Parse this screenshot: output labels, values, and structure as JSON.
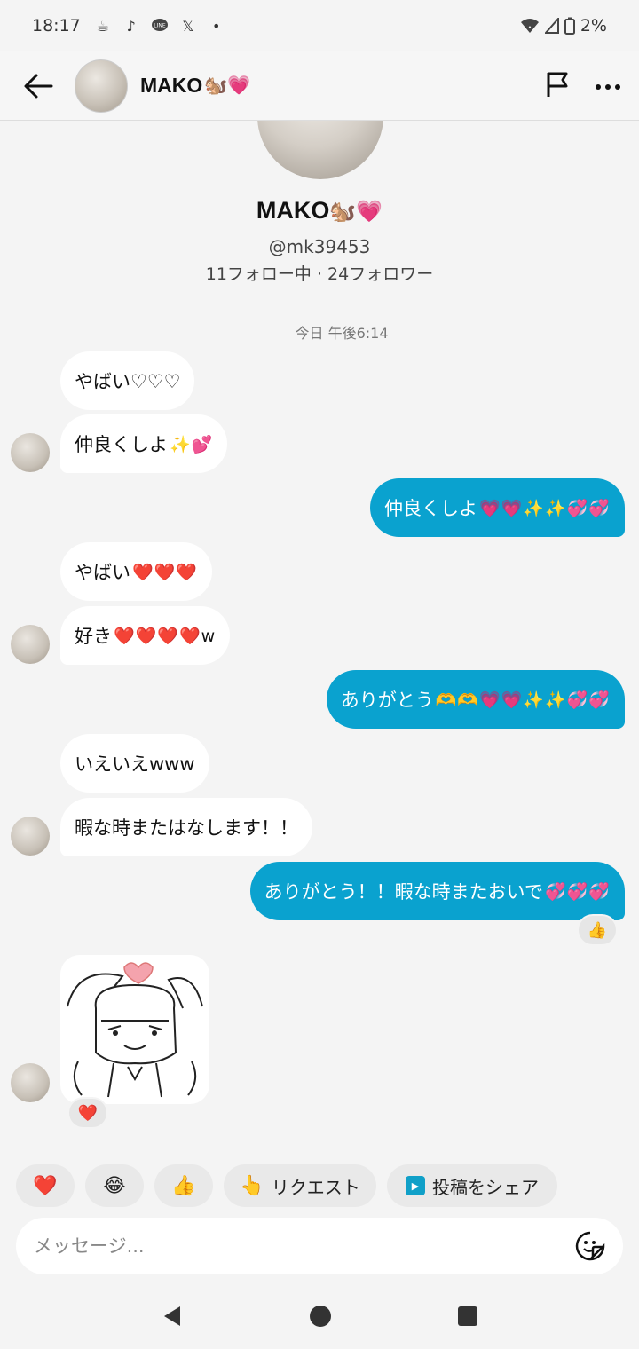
{
  "status_bar": {
    "time": "18:17",
    "battery": "2%",
    "icons": [
      "coffee-icon",
      "tiktok-icon",
      "line-icon",
      "x-icon",
      "dot-icon",
      "wifi-icon",
      "signal-icon",
      "battery-icon"
    ]
  },
  "header": {
    "name": "MAKO",
    "name_emoji": "🐿️💗",
    "back_icon": "arrow-left-icon",
    "flag_icon": "flag-icon",
    "more_icon": "more-icon"
  },
  "profile": {
    "name": "MAKO",
    "name_emoji": "🐿️💗",
    "handle": "@mk39453",
    "stats": "11フォロー中 · 24フォロワー"
  },
  "day_stamp": "今日 午後6:14",
  "messages": [
    {
      "text": "やばい♡♡♡",
      "emoji": ""
    },
    {
      "text": "仲良くしよ",
      "emoji": "✨💕"
    },
    {
      "text": "仲良くしよ",
      "emoji": "💗💗✨✨💞💞"
    },
    {
      "text": "やばい",
      "emoji": "❤️❤️❤️"
    },
    {
      "text": "好き",
      "emoji": "❤️❤️❤️❤️w"
    },
    {
      "text": "ありがとう",
      "emoji": "🫶🫶💗💗✨✨💞💞"
    },
    {
      "text": "いえいえwww",
      "emoji": ""
    },
    {
      "text": "暇な時またはなします！！",
      "emoji": ""
    },
    {
      "text": "ありがとう！！暇な時またおいで",
      "emoji": "💞💞💞"
    }
  ],
  "reactions": {
    "outgoing": "👍",
    "sticker": "❤️"
  },
  "quick_replies": [
    {
      "icon": "❤️",
      "label": ""
    },
    {
      "icon": "😂",
      "label": ""
    },
    {
      "icon": "👍",
      "label": ""
    },
    {
      "icon": "👆",
      "label": "リクエスト"
    },
    {
      "icon": "▶",
      "label": "投稿をシェア"
    }
  ],
  "composer": {
    "placeholder": "メッセージ..."
  },
  "colors": {
    "outgoing_bubble": "#0aa2cf",
    "incoming_bubble": "#ffffff",
    "background": "#f4f4f4"
  }
}
